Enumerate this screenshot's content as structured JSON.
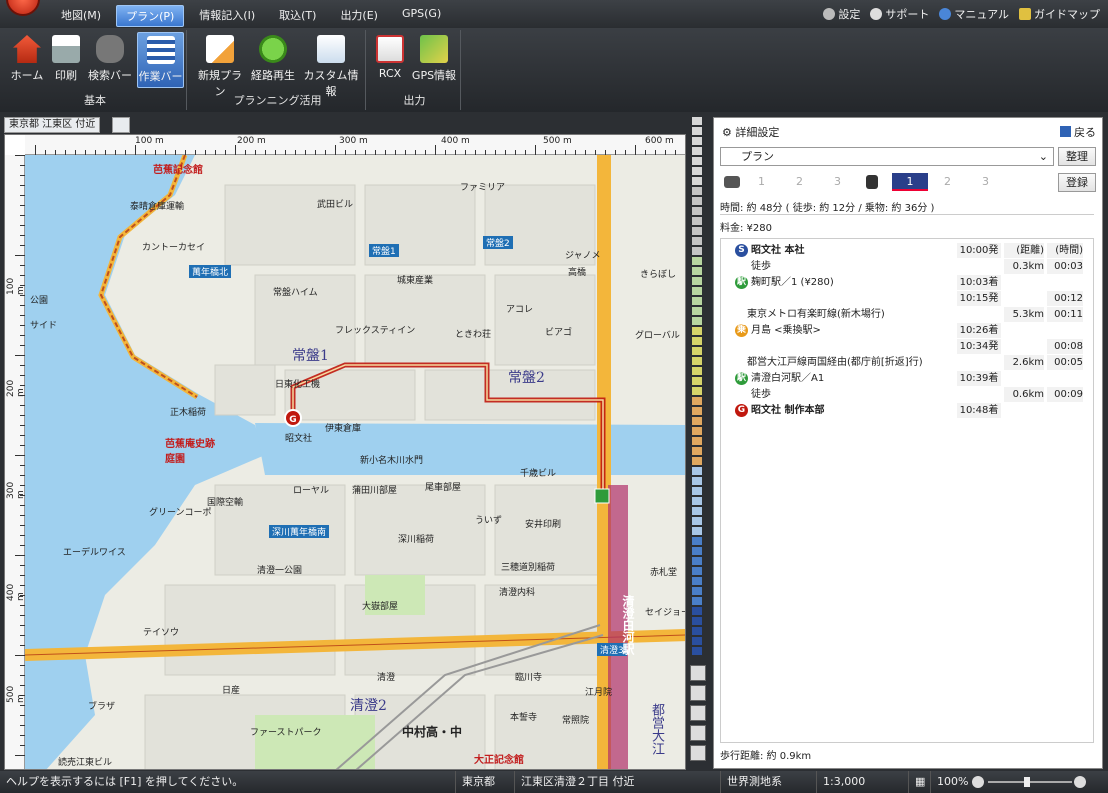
{
  "menubar": {
    "items": [
      "地図(M)",
      "プラン(P)",
      "情報記入(I)",
      "取込(T)",
      "出力(E)",
      "GPS(G)"
    ],
    "active_index": 1,
    "right": [
      "設定",
      "サポート",
      "マニュアル",
      "ガイドマップ"
    ]
  },
  "ribbon": {
    "groups": [
      {
        "label": "基本",
        "buttons": [
          "ホーム",
          "印刷",
          "検索バー",
          "作業バー"
        ]
      },
      {
        "label": "プランニング活用",
        "buttons": [
          "新規プラン",
          "経路再生",
          "カスタム情報"
        ]
      },
      {
        "label": "出力",
        "buttons": [
          "RCX",
          "GPS情報"
        ]
      }
    ],
    "active_button": "作業バー"
  },
  "doc_tab": "東京都 江東区 付近",
  "ruler": {
    "h_labels": [
      "100 m",
      "200 m",
      "300 m",
      "400 m",
      "500 m",
      "600 m"
    ],
    "v_labels": [
      "100 m",
      "200 m",
      "300 m",
      "400 m",
      "500 m"
    ]
  },
  "map_labels": {
    "big": [
      "常盤1",
      "常盤2",
      "清澄2"
    ],
    "places": [
      "芭蕉記念館",
      "泰晴倉庫運輸",
      "カントーカセイ",
      "武田ビル",
      "ファミリア",
      "城東産業",
      "常盤ハイム",
      "アコレ",
      "ジャノメ",
      "高橋",
      "きらぼし",
      "フレックスティイン",
      "ときわ荘",
      "ビアゴ",
      "グローバル",
      "日東化工機",
      "伊東倉庫",
      "昭文社",
      "正木稲荷",
      "芭蕉庵史跡庭園",
      "新小名木川水門",
      "ローヤル",
      "蒲田川部屋",
      "尾車部屋",
      "千歳ビル",
      "国際空輸",
      "グリーンコーポ",
      "ういず",
      "安井印刷",
      "深川稲荷",
      "エーデルワイス",
      "清澄一公園",
      "三穂道別稲荷",
      "赤札堂",
      "大嶽部屋",
      "清澄内科",
      "セイジョー",
      "テイソウ",
      "清澄",
      "臨川寺",
      "江月院",
      "日産",
      "ブラザ",
      "ファーストパーク",
      "中村高・中",
      "本誓寺",
      "常照院",
      "読売江東ビル",
      "大正記念館",
      "公園",
      "サイド"
    ],
    "roads": [
      "常盤1",
      "常盤2",
      "萬年橋北",
      "深川萬年橋南",
      "清澄3"
    ],
    "stations": [
      "清澄白河駅",
      "都営大江"
    ]
  },
  "panel": {
    "header": "詳細設定",
    "back": "戻る",
    "plan_select": "プラン",
    "organize": "整理",
    "register": "登録",
    "car_tabs": [
      "1",
      "2",
      "3"
    ],
    "train_tabs": [
      "1",
      "2",
      "3"
    ],
    "active_train": "1",
    "summary": "時間: 約 48分 ( 徒歩: 約 12分 / 乗物: 約 36分 )",
    "fare": "料金: ¥280",
    "headers": {
      "distance": "(距離)",
      "time": "(時間)"
    },
    "route": [
      {
        "kind": "start",
        "name": "昭文社 本社",
        "time": "10:00発",
        "dist": "(距離)",
        "dur": "(時間)"
      },
      {
        "kind": "walk",
        "name": "徒歩",
        "time": "",
        "dist": "0.3km",
        "dur": "00:03"
      },
      {
        "kind": "station",
        "name": "麹町駅／1 (¥280)",
        "time": "10:03着",
        "dist": "",
        "dur": ""
      },
      {
        "kind": "wait",
        "name": "",
        "time": "10:15発",
        "dist": "",
        "dur": "00:12"
      },
      {
        "kind": "line",
        "name": "東京メトロ有楽町線(新木場行)",
        "time": "",
        "dist": "5.3km",
        "dur": "00:11"
      },
      {
        "kind": "transfer",
        "name": "月島 <乗換駅>",
        "time": "10:26着",
        "dist": "",
        "dur": ""
      },
      {
        "kind": "wait",
        "name": "",
        "time": "10:34発",
        "dist": "",
        "dur": "00:08"
      },
      {
        "kind": "line",
        "name": "都営大江戸線両国経由(都庁前[折返]行)",
        "time": "",
        "dist": "2.6km",
        "dur": "00:05"
      },
      {
        "kind": "station",
        "name": "清澄白河駅／A1",
        "time": "10:39着",
        "dist": "",
        "dur": ""
      },
      {
        "kind": "walk",
        "name": "徒歩",
        "time": "",
        "dist": "0.6km",
        "dur": "00:09"
      },
      {
        "kind": "goal",
        "name": "昭文社 制作本部",
        "time": "10:48着",
        "dist": "",
        "dur": ""
      }
    ],
    "walk_distance": "歩行距離: 約 0.9km"
  },
  "status": {
    "help": "ヘルプを表示するには [F1] を押してください。",
    "pref": "東京都",
    "address": "江東区清澄２丁目 付近",
    "datum": "世界測地系",
    "scale": "1:3,000",
    "zoom": "100%"
  },
  "colors": {
    "route": "#c0180e",
    "river": "#8cc8ea",
    "road_major": "#f3b63b",
    "accent": "#3a77cf"
  }
}
